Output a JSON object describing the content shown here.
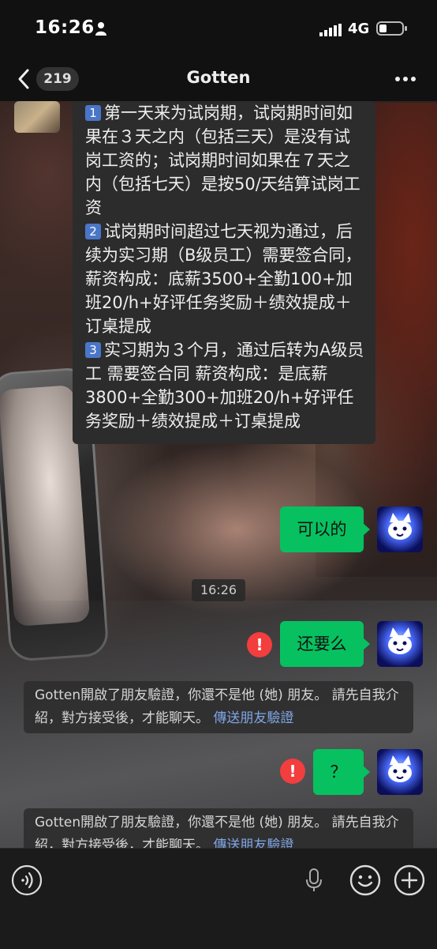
{
  "status_bar": {
    "time": "16:26",
    "network": "4G",
    "icons": [
      "person-icon",
      "signal-icon",
      "battery-icon"
    ]
  },
  "nav": {
    "back_count": "219",
    "title": "Gotten",
    "icons": [
      "back-chevron-icon",
      "more-icon"
    ]
  },
  "messages": {
    "incoming": {
      "lines": [
        {
          "badge": "1",
          "text": "第一天来为试岗期，试岗期时间如果在３天之内（包括三天）是没有试岗工资的；试岗期时间如果在７天之内（包括七天）是按50/天结算试岗工资"
        },
        {
          "badge": "2",
          "text": "试岗期时间超过七天视为通过，后续为实习期（B级员工）需要签合同，薪资构成：底薪3500+全勤100+加班20/h+好评任务奖励＋绩效提成＋订桌提成"
        },
        {
          "badge": "3",
          "text": "实习期为３个月，通过后转为A级员工 需要签合同  薪资构成：是底薪3800+全勤300+加班20/h+好评任务奖励＋绩效提成＋订桌提成"
        }
      ]
    },
    "outgoing_1": "可以的",
    "time_divider": "16:26",
    "outgoing_2": "还要么",
    "error_mark": "!",
    "notice_1": {
      "text": "Gotten開啟了朋友驗證，你還不是他 (她) 朋友。 請先自我介紹，對方接受後，才能聊天。",
      "link": "傳送朋友驗證"
    },
    "outgoing_3": "？",
    "notice_2": {
      "text": "Gotten開啟了朋友驗證，你還不是他 (她) 朋友。 請先自我介紹，對方接受後，才能聊天。",
      "link": "傳送朋友驗證"
    }
  },
  "input_bar": {
    "icons": [
      "voice-mode-icon",
      "microphone-icon",
      "emoji-icon",
      "add-icon"
    ]
  },
  "colors": {
    "bubble_out": "#07c160",
    "bubble_in": "#2c2c2c",
    "error": "#f23e3e",
    "link": "#7fa6e6"
  }
}
